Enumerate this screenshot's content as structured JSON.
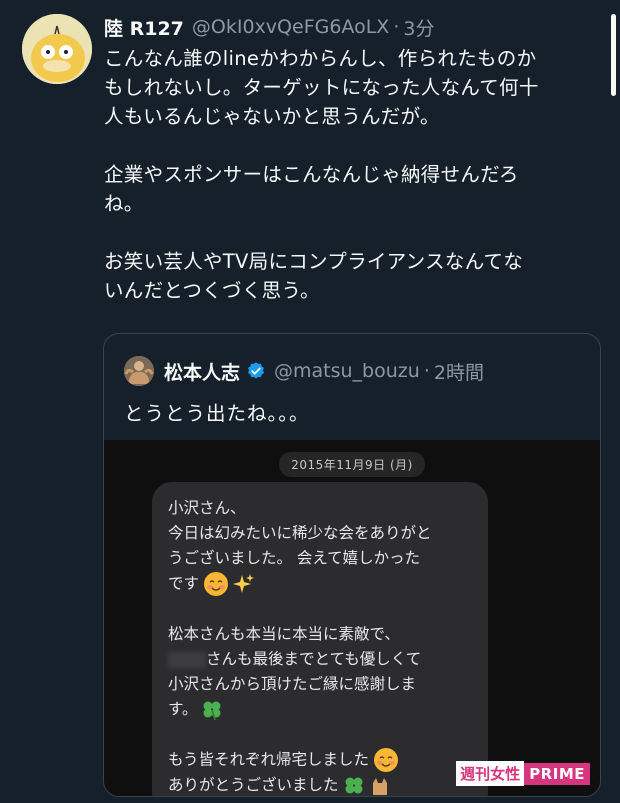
{
  "tweet": {
    "display_name": "陸 R127",
    "handle": "@OkI0xvQeFG6AoLX",
    "separator": "·",
    "time_ago": "3分",
    "paragraphs": [
      [
        "こんなん誰のlineかわからんし、作られたものか",
        "もしれないし。ターゲットになった人なんて何十",
        "人もいるんじゃないかと思うんだが。"
      ],
      [
        "企業やスポンサーはこんなんじゃ納得せんだろ",
        "ね。"
      ],
      [
        "お笑い芸人やTV局にコンプライアンスなんてな",
        "いんだとつくづく思う。"
      ]
    ]
  },
  "quote": {
    "display_name": "松本人志",
    "handle": "@matsu_bouzu",
    "separator": "·",
    "time_ago": "2時間",
    "text": "とうとう出たね。。。",
    "media": {
      "date": "2015年11月9日 (月)",
      "bubble": {
        "para1": [
          "小沢さん、",
          "今日は幻みたいに稀少な会をありがと",
          "うございました。 会えて嬉しかった",
          "です"
        ],
        "para2": [
          "松本さんも本当に本当に素敵で、",
          "さんも最後までとても優しくて",
          "小沢さんから頂けたご縁に感謝しま",
          "す。"
        ],
        "para3": [
          "もう皆それぞれ帰宅しました",
          "ありがとうございました"
        ]
      },
      "watermark": {
        "left": "週刊女性",
        "right": "PRIME"
      }
    }
  },
  "colors": {
    "background": "#15202b",
    "text": "#f7f9f9",
    "secondary": "#8b98a5",
    "border": "#38444d",
    "verified": "#1d9bf0",
    "watermark_pink": "#d6357f"
  }
}
